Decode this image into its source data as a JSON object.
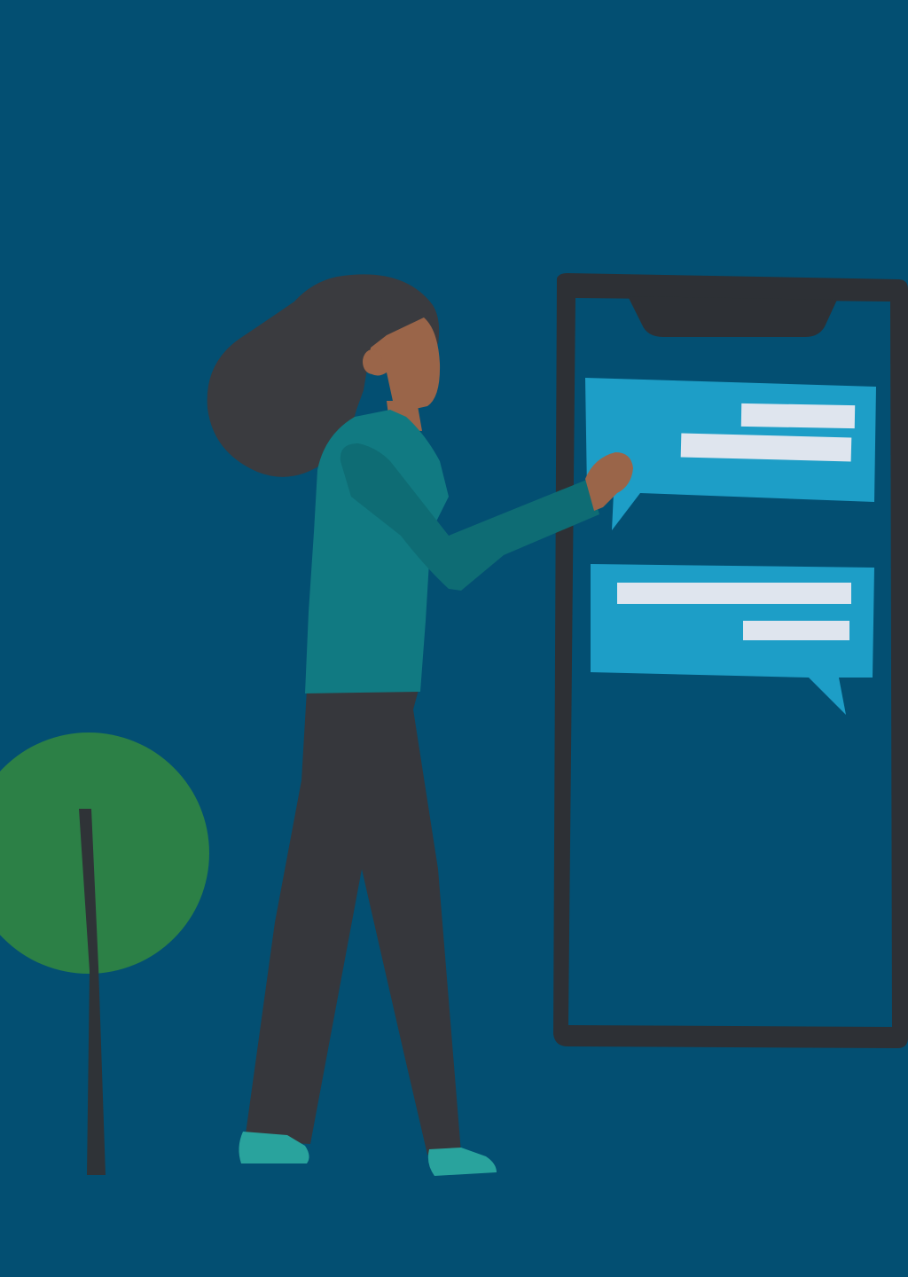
{
  "scene": {
    "description_elements": [
      "tree",
      "woman",
      "phone",
      "chat-bubble-top",
      "chat-bubble-bottom"
    ],
    "colors": {
      "background": "#034f72",
      "tree_canopy": "#2c8046",
      "tree_trunk": "#2f3337",
      "hair": "#3a3b3f",
      "skin": "#9a6549",
      "sweater": "#117a82",
      "sweater_shade": "#0e6c74",
      "pants": "#36373c",
      "shoes": "#29a39d",
      "phone_frame": "#2d3035",
      "phone_screen": "#034f72",
      "bubble": "#1d9ec7",
      "bubble_line": "#dfe5ee"
    }
  }
}
